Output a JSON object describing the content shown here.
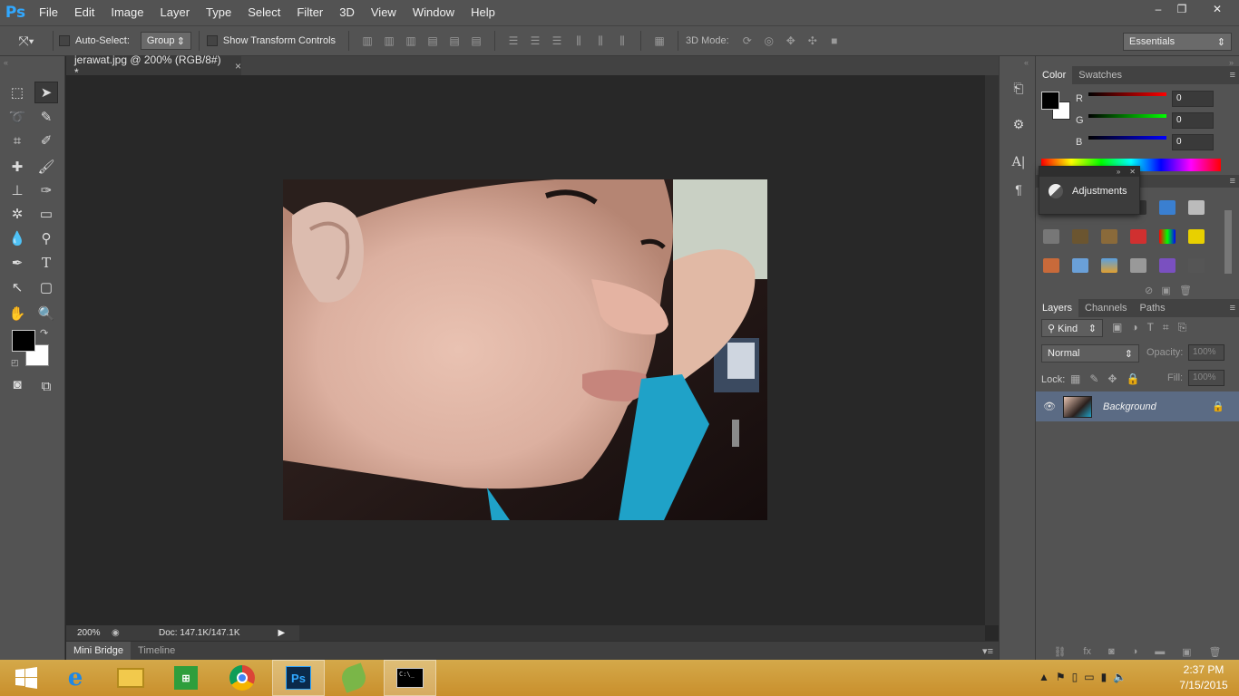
{
  "app": {
    "logo_text": "Ps"
  },
  "menu": [
    "File",
    "Edit",
    "Image",
    "Layer",
    "Type",
    "Select",
    "Filter",
    "3D",
    "View",
    "Window",
    "Help"
  ],
  "window_controls": {
    "minimize": "–",
    "restore": "❐",
    "close": "✕"
  },
  "options_bar": {
    "auto_select_label": "Auto-Select:",
    "auto_select_value": "Group",
    "show_transform_label": "Show Transform Controls",
    "mode3d_label": "3D Mode:",
    "workspace": "Essentials"
  },
  "document": {
    "tab_title": "jerawat.jpg @ 200% (RGB/8#) *",
    "close": "×"
  },
  "status": {
    "zoom": "200%",
    "doc_info": "Doc: 147.1K/147.1K"
  },
  "bottom_tabs": [
    "Mini Bridge",
    "Timeline"
  ],
  "color_panel": {
    "tabs": [
      "Color",
      "Swatches"
    ],
    "channels": [
      {
        "label": "R",
        "value": "0",
        "color": "#d82424"
      },
      {
        "label": "G",
        "value": "0",
        "color": "#24c024"
      },
      {
        "label": "B",
        "value": "0",
        "color": "#2424d8"
      }
    ]
  },
  "adjustments_popup": {
    "title": "Adjustments"
  },
  "layers_panel": {
    "tabs": [
      "Layers",
      "Channels",
      "Paths"
    ],
    "kind_label": "Kind",
    "blend_mode": "Normal",
    "opacity_label": "Opacity:",
    "opacity_value": "100%",
    "lock_label": "Lock:",
    "fill_label": "Fill:",
    "fill_value": "100%",
    "layers": [
      {
        "name": "Background",
        "visible": true,
        "locked": true
      }
    ]
  },
  "taskbar": {
    "apps": [
      "ie-icon",
      "file-explorer-icon",
      "store-icon",
      "chrome-icon",
      "photoshop-icon",
      "corel-icon",
      "cmd-icon"
    ],
    "time": "2:37 PM",
    "date": "7/15/2015"
  },
  "colors": {
    "accent_ps": "#31a8ff",
    "layer_selected": "#5b6b84"
  }
}
